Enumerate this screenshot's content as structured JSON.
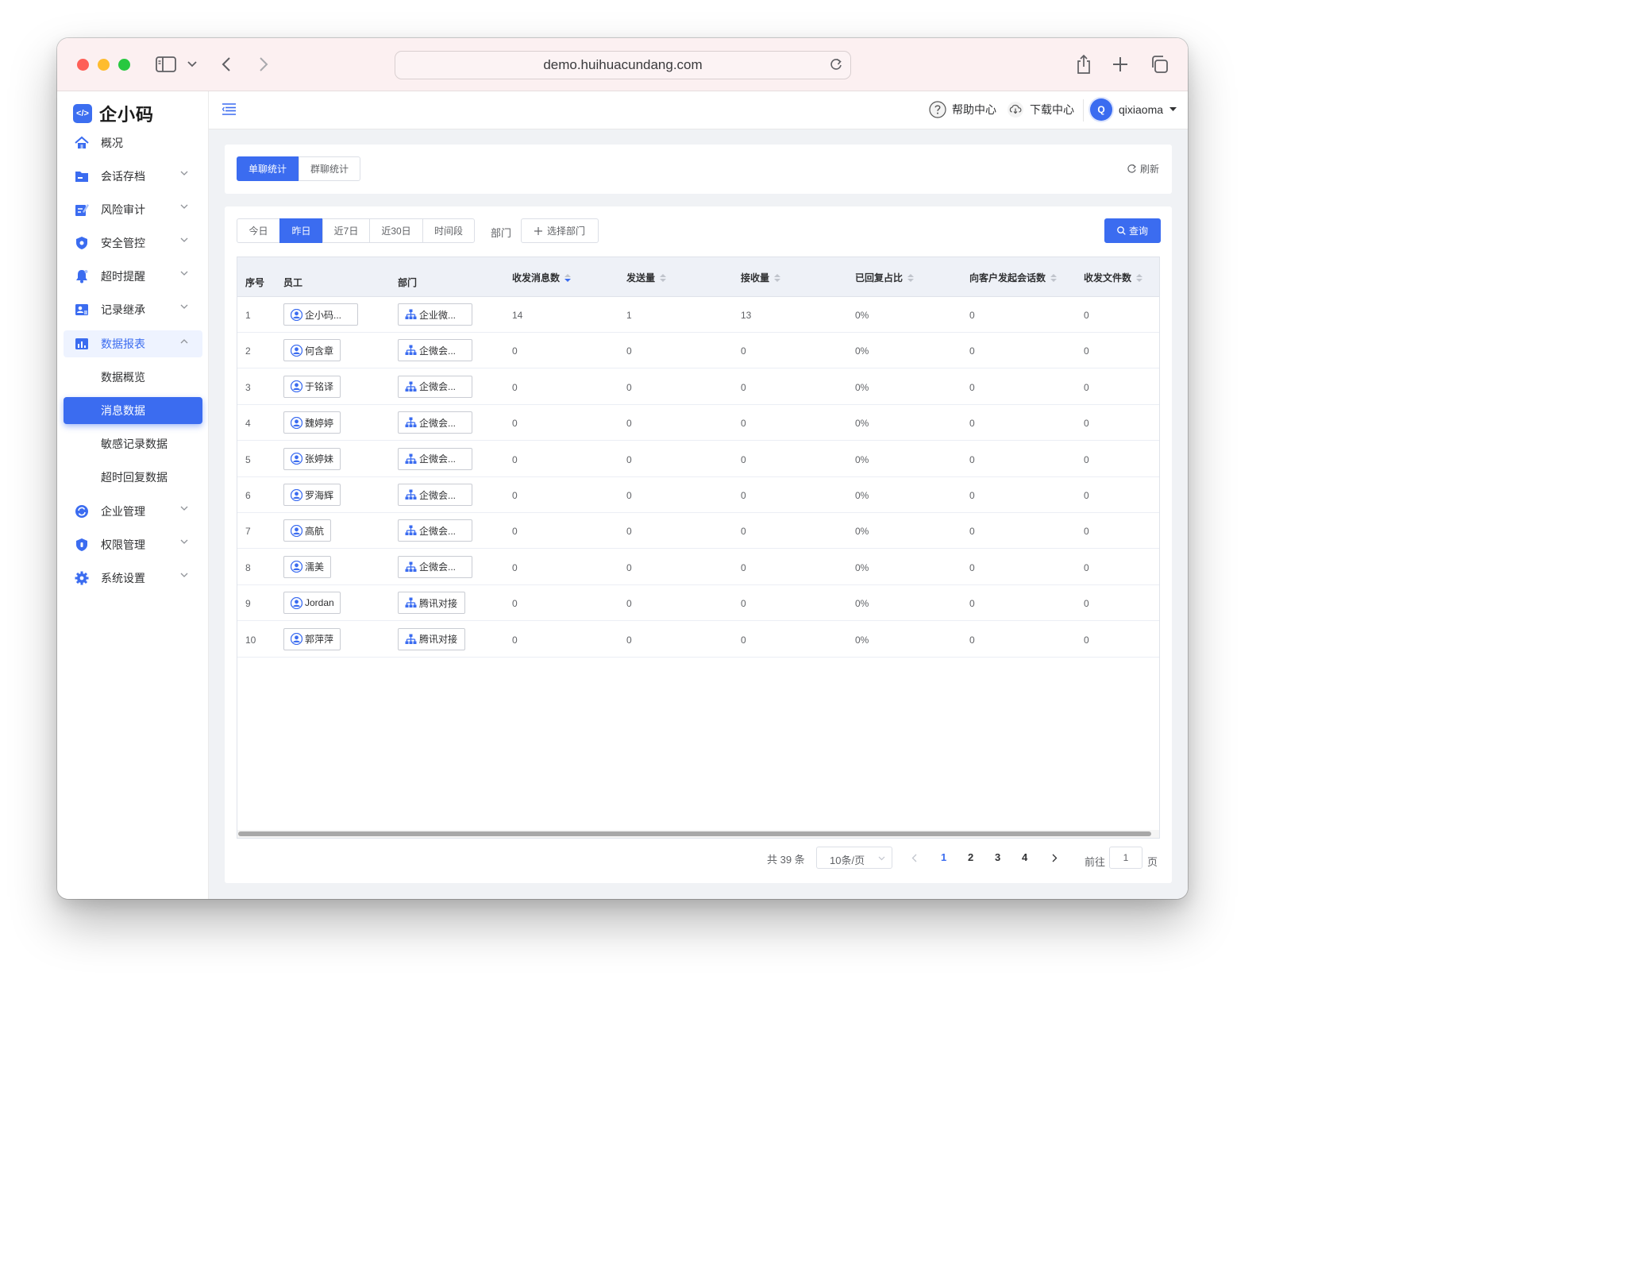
{
  "browser": {
    "url": "demo.huihuacundang.com"
  },
  "brand": {
    "name": "企小码",
    "accent": "#3b6cf0"
  },
  "sidebar": {
    "items": [
      {
        "label": "概况",
        "icon": "home-icon"
      },
      {
        "label": "会话存档",
        "icon": "folder-icon"
      },
      {
        "label": "风险审计",
        "icon": "edit-icon"
      },
      {
        "label": "安全管控",
        "icon": "shield-icon"
      },
      {
        "label": "超时提醒",
        "icon": "bell-icon"
      },
      {
        "label": "记录继承",
        "icon": "person-card-icon"
      },
      {
        "label": "数据报表",
        "icon": "bar-chart-icon"
      },
      {
        "label": "企业管理",
        "icon": "refresh-circle-icon"
      },
      {
        "label": "权限管理",
        "icon": "lock-shield-icon"
      },
      {
        "label": "系统设置",
        "icon": "gear-icon"
      }
    ],
    "subitems": [
      {
        "label": "数据概览"
      },
      {
        "label": "消息数据"
      },
      {
        "label": "敏感记录数据"
      },
      {
        "label": "超时回复数据"
      }
    ]
  },
  "topnav": {
    "help": "帮助中心",
    "download": "下载中心",
    "user": "qixiaoma",
    "avatar": "Q"
  },
  "tabs": {
    "single": "单聊统计",
    "group": "群聊统计",
    "refresh": "刷新"
  },
  "filters": {
    "dates": [
      "今日",
      "昨日",
      "近7日",
      "近30日",
      "时间段"
    ],
    "dept_label": "部门",
    "dept_select": "选择部门",
    "query": "查询"
  },
  "table": {
    "headers": [
      "序号",
      "员工",
      "部门",
      "收发消息数",
      "发送量",
      "接收量",
      "已回复占比",
      "向客户发起会话数",
      "收发文件数"
    ],
    "rows": [
      {
        "idx": "1",
        "emp": "企小码...",
        "dept": "企业微...",
        "total": "14",
        "sent": "1",
        "recv": "13",
        "ratio": "0%",
        "init": "0",
        "files": "0"
      },
      {
        "idx": "2",
        "emp": "何含章",
        "dept": "企微会...",
        "total": "0",
        "sent": "0",
        "recv": "0",
        "ratio": "0%",
        "init": "0",
        "files": "0"
      },
      {
        "idx": "3",
        "emp": "于铭译",
        "dept": "企微会...",
        "total": "0",
        "sent": "0",
        "recv": "0",
        "ratio": "0%",
        "init": "0",
        "files": "0"
      },
      {
        "idx": "4",
        "emp": "魏婷婷",
        "dept": "企微会...",
        "total": "0",
        "sent": "0",
        "recv": "0",
        "ratio": "0%",
        "init": "0",
        "files": "0"
      },
      {
        "idx": "5",
        "emp": "张婷妹",
        "dept": "企微会...",
        "total": "0",
        "sent": "0",
        "recv": "0",
        "ratio": "0%",
        "init": "0",
        "files": "0"
      },
      {
        "idx": "6",
        "emp": "罗海辉",
        "dept": "企微会...",
        "total": "0",
        "sent": "0",
        "recv": "0",
        "ratio": "0%",
        "init": "0",
        "files": "0"
      },
      {
        "idx": "7",
        "emp": "高航",
        "dept": "企微会...",
        "total": "0",
        "sent": "0",
        "recv": "0",
        "ratio": "0%",
        "init": "0",
        "files": "0"
      },
      {
        "idx": "8",
        "emp": "濡美",
        "dept": "企微会...",
        "total": "0",
        "sent": "0",
        "recv": "0",
        "ratio": "0%",
        "init": "0",
        "files": "0"
      },
      {
        "idx": "9",
        "emp": "Jordan",
        "dept": "腾讯对接",
        "total": "0",
        "sent": "0",
        "recv": "0",
        "ratio": "0%",
        "init": "0",
        "files": "0"
      },
      {
        "idx": "10",
        "emp": "郭萍萍",
        "dept": "腾讯对接",
        "total": "0",
        "sent": "0",
        "recv": "0",
        "ratio": "0%",
        "init": "0",
        "files": "0"
      }
    ]
  },
  "pagination": {
    "total": "共 39 条",
    "page_size": "10条/页",
    "pages": [
      "1",
      "2",
      "3",
      "4"
    ],
    "goto_label": "前往",
    "goto_value": "1",
    "page_unit": "页"
  }
}
